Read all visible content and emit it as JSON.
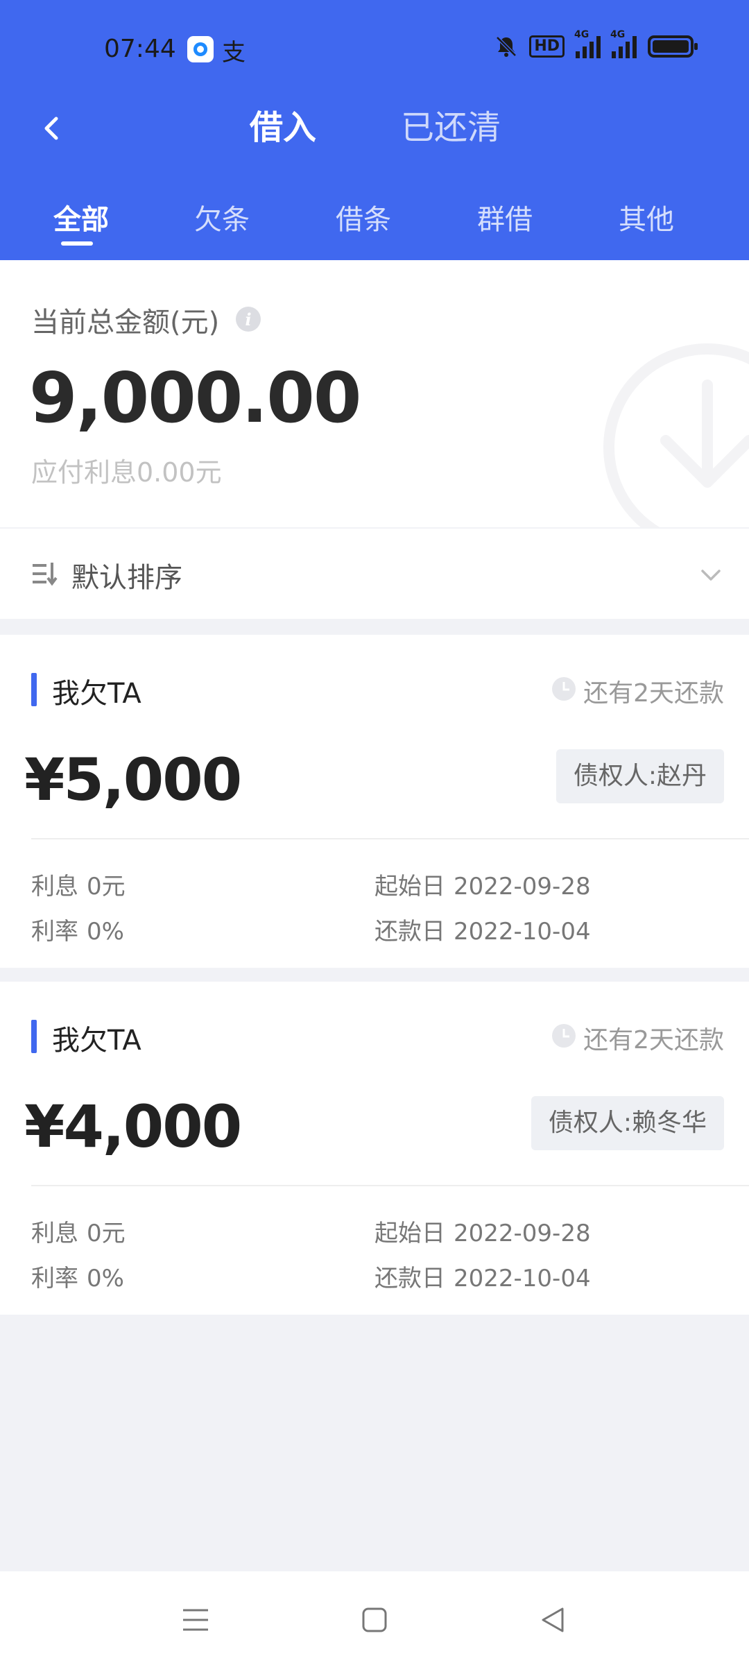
{
  "status_bar": {
    "time": "07:44",
    "app_icon_2": "支",
    "hd_label": "HD",
    "network_label": "4G",
    "network_label_2": "4G"
  },
  "header": {
    "tabs": [
      {
        "label": "借入",
        "active": true
      },
      {
        "label": "已还清",
        "active": false
      }
    ],
    "subtabs": [
      {
        "label": "全部",
        "active": true
      },
      {
        "label": "欠条",
        "active": false
      },
      {
        "label": "借条",
        "active": false
      },
      {
        "label": "群借",
        "active": false
      },
      {
        "label": "其他",
        "active": false
      }
    ]
  },
  "summary": {
    "label": "当前总金额(元)",
    "info_glyph": "i",
    "amount": "9,000.00",
    "interest": "应付利息0.00元"
  },
  "sort": {
    "label": "默认排序"
  },
  "records": [
    {
      "type": "我欠TA",
      "due": "还有2天还款",
      "amount": "¥5,000",
      "creditor": "债权人:赵丹",
      "interest_label": "利息",
      "interest_value": "0元",
      "rate_label": "利率",
      "rate_value": "0%",
      "start_label": "起始日",
      "start_value": "2022-09-28",
      "end_label": "还款日",
      "end_value": "2022-10-04"
    },
    {
      "type": "我欠TA",
      "due": "还有2天还款",
      "amount": "¥4,000",
      "creditor": "债权人:赖冬华",
      "interest_label": "利息",
      "interest_value": "0元",
      "rate_label": "利率",
      "rate_value": "0%",
      "start_label": "起始日",
      "start_value": "2022-09-28",
      "end_label": "还款日",
      "end_value": "2022-10-04"
    }
  ],
  "colors": {
    "brand": "#4068ef",
    "background": "#f1f2f6"
  },
  "icons": {
    "back": "chevron-left-icon",
    "info": "info-icon",
    "sort": "sort-list-icon",
    "dropdown": "chevron-down-icon",
    "clock": "clock-icon",
    "menu": "menu-icon",
    "home": "square-home-icon",
    "back_nav": "triangle-back-icon"
  }
}
